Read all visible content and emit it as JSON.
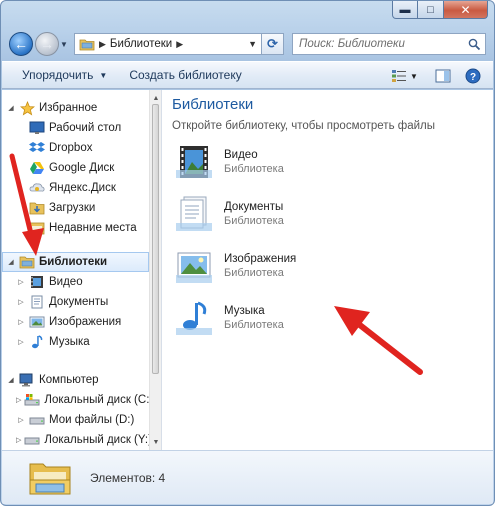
{
  "window": {
    "controls": {
      "minimize": "▬",
      "maximize": "□",
      "close": "✕"
    }
  },
  "address": {
    "crumb": "Библиотеки",
    "search_placeholder": "Поиск: Библиотеки"
  },
  "toolbar": {
    "organize": "Упорядочить",
    "new_library": "Создать библиотеку"
  },
  "nav": {
    "favorites": {
      "label": "Избранное",
      "items": [
        "Рабочий стол",
        "Dropbox",
        "Google Диск",
        "Яндекс.Диск",
        "Загрузки",
        "Недавние места"
      ]
    },
    "libraries": {
      "label": "Библиотеки",
      "items": [
        "Видео",
        "Документы",
        "Изображения",
        "Музыка"
      ]
    },
    "computer": {
      "label": "Компьютер",
      "items": [
        "Локальный диск (C:)",
        "Мои файлы (D:)",
        "Локальный диск (Y:)"
      ]
    }
  },
  "content": {
    "title": "Библиотеки",
    "subtitle": "Откройте библиотеку, чтобы просмотреть файлы",
    "items": [
      {
        "name": "Видео",
        "type": "Библиотека",
        "icon": "video-library-icon"
      },
      {
        "name": "Документы",
        "type": "Библиотека",
        "icon": "documents-library-icon"
      },
      {
        "name": "Изображения",
        "type": "Библиотека",
        "icon": "pictures-library-icon"
      },
      {
        "name": "Музыка",
        "type": "Библиотека",
        "icon": "music-library-icon"
      }
    ]
  },
  "details": {
    "count": "Элементов: 4"
  },
  "colors": {
    "accent": "#1e5aa0",
    "annotation_arrow": "#e0241f"
  }
}
